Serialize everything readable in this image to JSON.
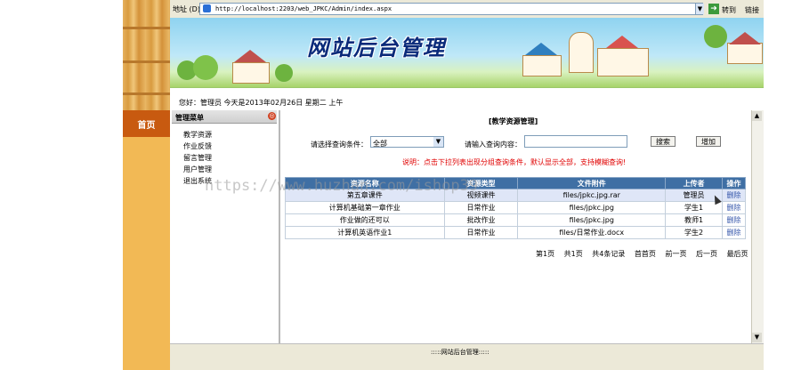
{
  "browser": {
    "address_label": "地址 (D)",
    "url": "http://localhost:2203/web_JPKC/Admin/index.aspx",
    "go_label": "转到",
    "links_label": "链接"
  },
  "banner": {
    "title": "网站后台管理"
  },
  "greeting": "您好：管理员   今天是2013年02月26日  星期二   上午",
  "sidebar": {
    "home_tab": "首页",
    "menu_title": "管理菜单",
    "items": [
      {
        "label": "教学资源"
      },
      {
        "label": "作业反馈"
      },
      {
        "label": "留言管理"
      },
      {
        "label": "用户管理"
      },
      {
        "label": "退出系统"
      }
    ]
  },
  "watermark": "https://www.huzhan.com/ishop39",
  "content": {
    "title": "[教学资源管理]",
    "condition_label": "请选择查询条件：",
    "condition_value": "全部",
    "query_label": "请输入查询内容：",
    "query_value": "",
    "search_button": "搜索",
    "add_button": "增加",
    "note": "说明：点击下拉列表出现分组查询条件，默认显示全部，支持模糊查询!"
  },
  "table": {
    "headers": [
      "资源名称",
      "资源类型",
      "文件附件",
      "上传者",
      "操作"
    ],
    "rows": [
      {
        "name": "第五章课件",
        "type": "视频课件",
        "file": "files/jpkc.jpg.rar",
        "uploader": "管理员",
        "action": "删除"
      },
      {
        "name": "计算机基础第一章作业",
        "type": "日常作业",
        "file": "files/jpkc.jpg",
        "uploader": "学生1",
        "action": "删除"
      },
      {
        "name": "作业做的还可以",
        "type": "批改作业",
        "file": "files/jpkc.jpg",
        "uploader": "教师1",
        "action": "删除"
      },
      {
        "name": "计算机英语作业1",
        "type": "日常作业",
        "file": "files/日常作业.docx",
        "uploader": "学生2",
        "action": "删除"
      }
    ]
  },
  "pager": {
    "page": "第1页",
    "total_pages": "共1页",
    "total_records": "共4条记录",
    "first": "首首页",
    "prev": "前一页",
    "next": "后一页",
    "last": "最后页"
  },
  "footer": ":::::网站后台管理:::::"
}
